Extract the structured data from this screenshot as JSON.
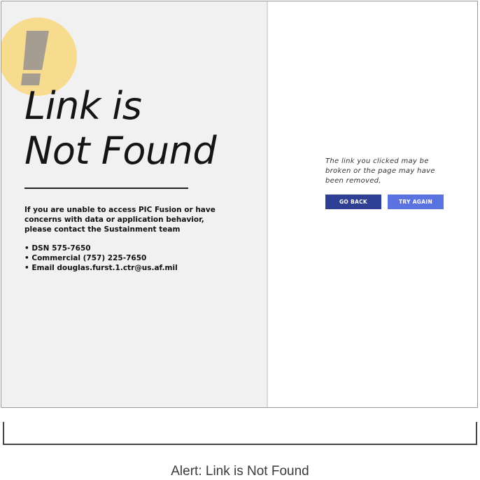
{
  "error": {
    "title_line1": "Link is",
    "title_line2": "Not Found",
    "contact_intro": "If you are unable to access PIC Fusion or have concerns with data or application behavior, please contact the Sustainment team",
    "contacts": [
      "• DSN 575-7650",
      "• Commercial (757) 225-7650",
      "• Email douglas.furst.1.ctr@us.af.mil"
    ],
    "badge_icon": "exclamation-icon",
    "badge_color": "#f7dc8f"
  },
  "message": {
    "text": "The link you clicked may be broken or the page may have been removed,"
  },
  "actions": {
    "go_back_label": "GO BACK",
    "try_again_label": "TRY AGAIN",
    "go_back_color": "#2e3f94",
    "try_again_color": "#5a73e0"
  },
  "caption": "Alert: Link is Not Found"
}
